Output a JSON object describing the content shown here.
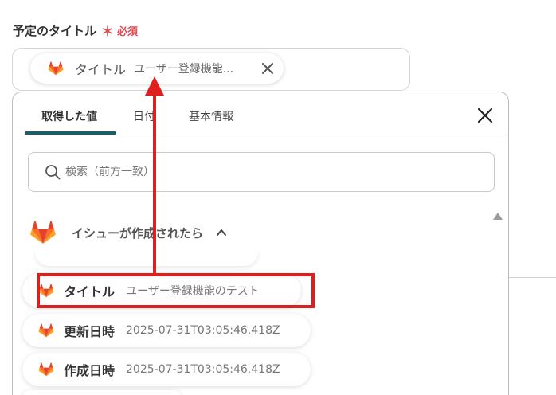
{
  "form": {
    "label": "予定のタイトル",
    "required_star": "＊",
    "required_text": "必須"
  },
  "chip": {
    "title": "タイトル",
    "value": "ユーザー登録機能..."
  },
  "tabs": [
    {
      "label": "取得した値",
      "active": true
    },
    {
      "label": "日付",
      "active": false
    },
    {
      "label": "基本情報",
      "active": false
    }
  ],
  "search": {
    "placeholder": "検索（前方一致）"
  },
  "section": {
    "label": "イシューが作成されたら"
  },
  "items": [
    {
      "title": "タイトル",
      "value": "ユーザー登録機能のテスト"
    },
    {
      "title": "更新日時",
      "value": "2025-07-31T03:05:46.418Z"
    },
    {
      "title": "作成日時",
      "value": "2025-07-31T03:05:46.418Z"
    }
  ],
  "colors": {
    "required": "#e5484d",
    "tab_underline": "#1a5d6d",
    "highlight": "#e01e1e",
    "gitlab_orange": "#fc6d26",
    "gitlab_red": "#e24329",
    "gitlab_amber": "#fca326"
  },
  "icons": [
    "gitlab-icon",
    "close-icon",
    "search-icon",
    "chevron-up-icon",
    "scroll-up-icon"
  ]
}
